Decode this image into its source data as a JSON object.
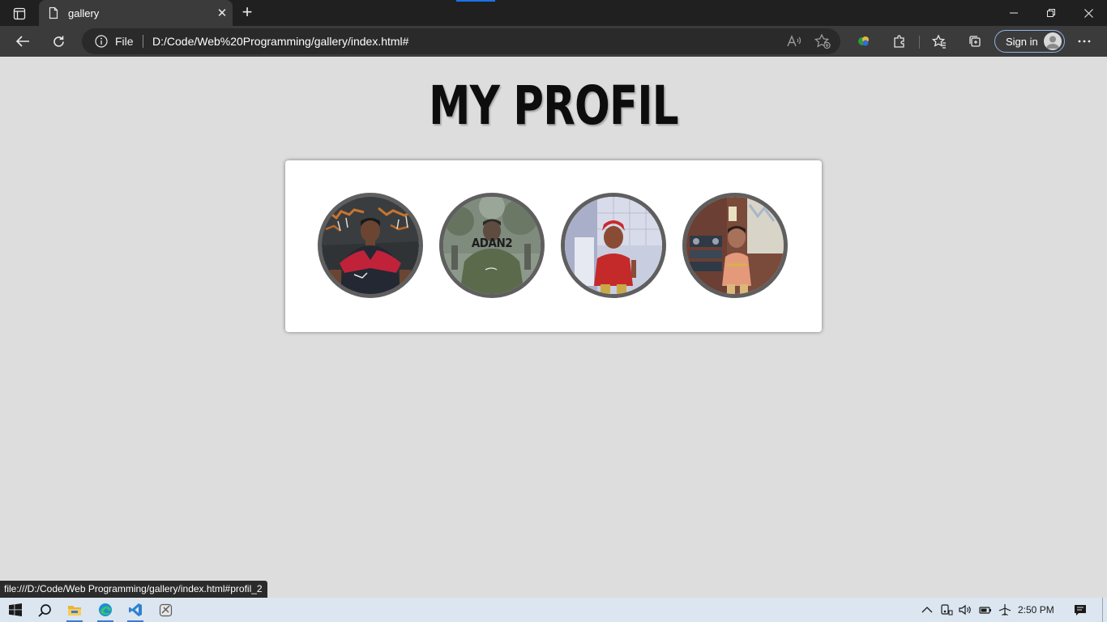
{
  "browser": {
    "tab_title": "gallery",
    "close_tab_glyph": "✕",
    "new_tab_glyph": "+",
    "scheme_label": "File",
    "url": "D:/Code/Web%20Programming/gallery/index.html#",
    "sign_in_label": "Sign in",
    "accent_color": "#1a73e8"
  },
  "page": {
    "title": "MY PROFIL",
    "photos": [
      {
        "alt": "profil_1",
        "label": ""
      },
      {
        "alt": "profil_2",
        "label": "ADAN2"
      },
      {
        "alt": "profil_3",
        "label": ""
      },
      {
        "alt": "profil_4",
        "label": ""
      }
    ]
  },
  "status_url": "file:///D:/Code/Web Programming/gallery/index.html#profil_2",
  "taskbar": {
    "time": "2:50 PM",
    "apps": [
      "start-icon",
      "search-icon",
      "file-explorer-icon",
      "edge-icon",
      "vscode-icon",
      "snipping-tool-icon"
    ]
  }
}
